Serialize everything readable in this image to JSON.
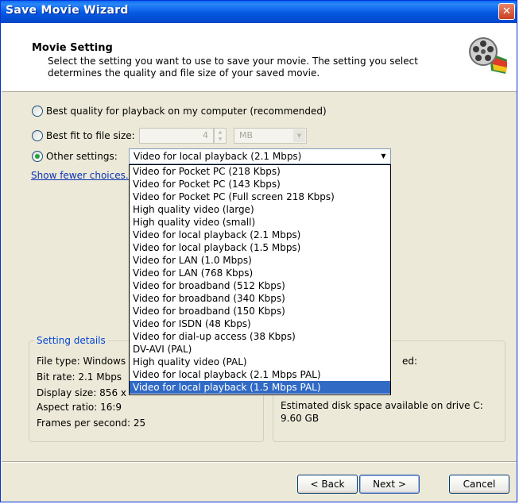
{
  "window": {
    "title": "Save Movie Wizard",
    "close_glyph": "✕"
  },
  "header": {
    "title": "Movie Setting",
    "description": "Select the setting you want to use to save your movie. The setting you select determines the quality and file size of your saved movie.",
    "icon": "film-reel-icon"
  },
  "options": {
    "best_quality_label": "Best quality for playback on my computer (recommended)",
    "best_fit_label": "Best fit to file size:",
    "file_size_value": "4",
    "file_size_unit": "MB",
    "other_settings_label": "Other settings:",
    "other_settings_value": "Video for local playback (2.1 Mbps)",
    "selected_option": "other_settings",
    "show_fewer_link": "Show fewer choices..."
  },
  "dropdown": {
    "items": [
      "Video for Pocket PC (218 Kbps)",
      "Video for Pocket PC (143 Kbps)",
      "Video for Pocket PC (Full screen 218 Kbps)",
      "High quality video (large)",
      "High quality video (small)",
      "Video for local playback (2.1 Mbps)",
      "Video for local playback (1.5 Mbps)",
      "Video for LAN (1.0 Mbps)",
      "Video for LAN (768 Kbps)",
      "Video for broadband (512 Kbps)",
      "Video for broadband (340 Kbps)",
      "Video for broadband (150 Kbps)",
      "Video for ISDN (48 Kbps)",
      "Video for dial-up access (38 Kbps)",
      "DV-AVI (PAL)",
      "High quality video (PAL)",
      "Video for local playback (2.1 Mbps PAL)",
      "Video for local playback (1.5 Mbps PAL)"
    ],
    "highlighted_index": 17
  },
  "setting_details": {
    "legend": "Setting details",
    "file_type": "File type: Windows",
    "bit_rate": "Bit rate: 2.1 Mbps",
    "display_size": "Display size: 856 x",
    "aspect_ratio": "Aspect ratio: 16:9",
    "frames_per_second": "Frames per second: 25"
  },
  "file_info": {
    "partial_label": "ed:",
    "disk_space_label": "Estimated disk space available on drive C:",
    "disk_space_value": "9.60 GB"
  },
  "buttons": {
    "back": "< Back",
    "next": "Next >",
    "cancel": "Cancel"
  },
  "colors": {
    "title_bar": "#0558e2",
    "selection": "#316ac5",
    "link": "#0b35b3",
    "group_legend": "#0046d5"
  }
}
